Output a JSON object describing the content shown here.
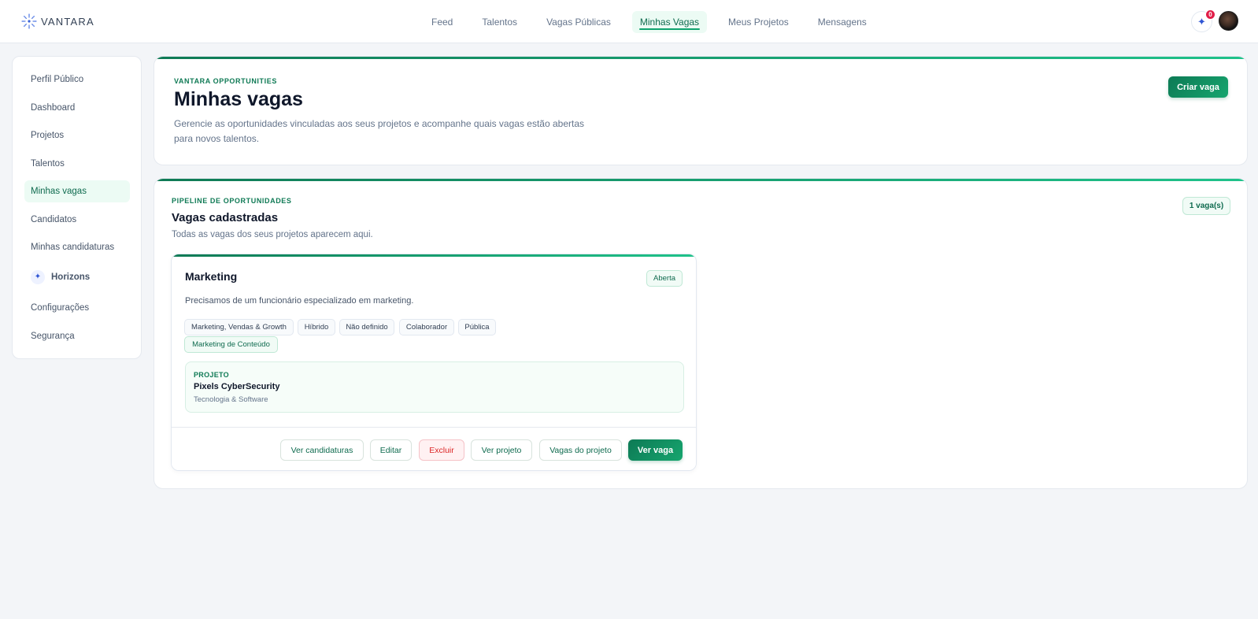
{
  "brand": {
    "name": "VANTARA"
  },
  "nav": {
    "items": [
      {
        "label": "Feed",
        "active": false
      },
      {
        "label": "Talentos",
        "active": false
      },
      {
        "label": "Vagas Públicas",
        "active": false
      },
      {
        "label": "Minhas Vagas",
        "active": true
      },
      {
        "label": "Meus Projetos",
        "active": false
      },
      {
        "label": "Mensagens",
        "active": false
      }
    ]
  },
  "topbar": {
    "ai_icon": "sparkle-icon",
    "notification_count": "0",
    "avatar": "user-avatar"
  },
  "sidebar": {
    "items": [
      {
        "label": "Perfil Público"
      },
      {
        "label": "Dashboard"
      },
      {
        "label": "Projetos"
      },
      {
        "label": "Talentos"
      },
      {
        "label": "Minhas vagas",
        "active": true
      },
      {
        "label": "Candidatos"
      },
      {
        "label": "Minhas candidaturas"
      },
      {
        "label": "Horizons",
        "icon": "sparkle-icon"
      },
      {
        "label": "Configurações"
      },
      {
        "label": "Segurança"
      }
    ]
  },
  "header": {
    "eyebrow": "VANTARA OPPORTUNITIES",
    "title": "Minhas vagas",
    "description_line1": "Gerencie as oportunidades vinculadas aos seus projetos e acompanhe quais vagas estão abertas",
    "description_line2": "para novos talentos.",
    "create_button": "Criar vaga"
  },
  "pipeline": {
    "eyebrow": "PIPELINE DE OPORTUNIDADES",
    "title": "Vagas cadastradas",
    "subtitle": "Todas as vagas dos seus projetos aparecem aqui.",
    "count_label": "1 vaga(s)"
  },
  "jobs": [
    {
      "title": "Marketing",
      "status": "Aberta",
      "description": "Precisamos de um funcionário especializado em marketing.",
      "tags": [
        "Marketing, Vendas & Growth",
        "Híbrido",
        "Não definido",
        "Colaborador",
        "Pública"
      ],
      "highlight_tag": "Marketing de Conteúdo",
      "project": {
        "label": "PROJETO",
        "name": "Pixels CyberSecurity",
        "category": "Tecnologia & Software"
      },
      "actions": {
        "applications": "Ver candidaturas",
        "edit": "Editar",
        "delete": "Excluir",
        "view_project": "Ver projeto",
        "project_jobs": "Vagas do projeto",
        "view_job": "Ver vaga"
      }
    }
  ],
  "colors": {
    "accent": "#10a36f",
    "accent_dark": "#0f6b4f",
    "danger": "#dc2626",
    "background": "#f3f5f8"
  }
}
